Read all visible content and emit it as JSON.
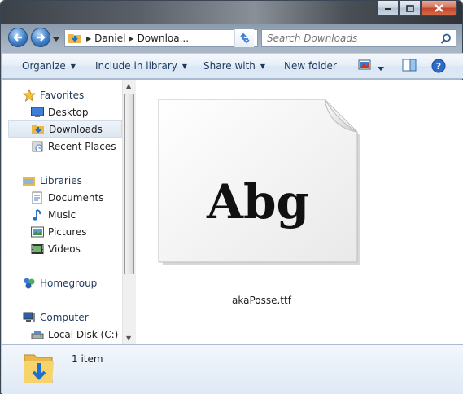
{
  "window": {
    "caption_buttons": [
      "minimize",
      "maximize",
      "close"
    ]
  },
  "address_bar": {
    "crumbs": [
      "Daniel",
      "Downloa..."
    ],
    "search_placeholder": "Search Downloads"
  },
  "command_bar": {
    "organize": "Organize",
    "include_in_library": "Include in library",
    "share_with": "Share with",
    "new_folder": "New folder"
  },
  "nav_pane": {
    "favorites": "Favorites",
    "desktop": "Desktop",
    "downloads": "Downloads",
    "recent_places": "Recent Places",
    "libraries": "Libraries",
    "documents": "Documents",
    "music": "Music",
    "pictures": "Pictures",
    "videos": "Videos",
    "homegroup": "Homegroup",
    "computer": "Computer",
    "local_disk": "Local Disk (C:)"
  },
  "content": {
    "thumbnail_text": "Abg",
    "file_name": "akaPosse.ttf"
  },
  "details": {
    "item_count": "1 item"
  },
  "colors": {
    "accent": "#1e395b",
    "selection": "#dde7f1",
    "folder": "#f2c84b"
  }
}
